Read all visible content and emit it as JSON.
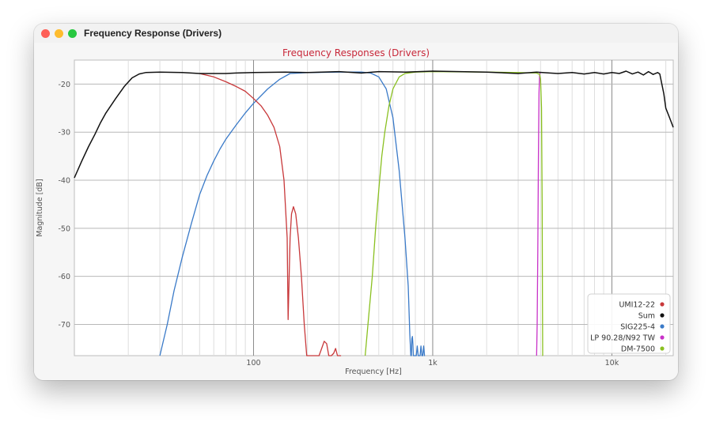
{
  "window": {
    "title": "Frequency Response (Drivers)"
  },
  "chart_data": {
    "type": "line",
    "title": "Frequency Responses (Drivers)",
    "xlabel": "Frequency [Hz]",
    "ylabel": "Magnitude [dB]",
    "xscale": "log",
    "xlim": [
      10,
      22000
    ],
    "ylim": [
      -76.5,
      -15
    ],
    "x_ticks": [
      100,
      1000,
      10000
    ],
    "x_tick_labels": [
      "100",
      "1k",
      "10k"
    ],
    "y_ticks": [
      -20,
      -30,
      -40,
      -50,
      -60,
      -70
    ],
    "grid": true,
    "legend_position": "bottom-right",
    "colors": {
      "title": "#c8283a",
      "axis_text": "#555555"
    },
    "series": [
      {
        "name": "UMI12-22",
        "color": "#c8383a",
        "x": [
          50,
          60,
          70,
          80,
          90,
          100,
          110,
          120,
          130,
          140,
          148,
          154,
          156,
          158,
          160,
          163,
          167,
          172,
          178,
          185,
          192,
          198,
          203,
          210,
          220,
          232,
          240,
          248,
          256,
          263,
          272,
          280,
          287,
          294,
          300,
          308
        ],
        "y": [
          -17.8,
          -18.5,
          -19.5,
          -20.5,
          -21.5,
          -23,
          -24.5,
          -26.5,
          -29,
          -33,
          -40,
          -52,
          -69,
          -60,
          -52,
          -47,
          -45.5,
          -47,
          -52,
          -60,
          -70,
          -76.5,
          -76.5,
          -76.5,
          -76.5,
          -76.5,
          -75,
          -73.5,
          -74,
          -76.5,
          -76.5,
          -76,
          -75,
          -76.5,
          -76.5,
          -76.5
        ]
      },
      {
        "name": "Sum",
        "color": "#111111",
        "x": [
          10,
          11,
          12,
          13,
          14,
          15,
          17,
          19,
          21,
          23,
          25,
          30,
          40,
          50,
          60,
          70,
          80,
          100,
          150,
          200,
          300,
          400,
          500,
          700,
          1000,
          2000,
          3000,
          3800,
          4500,
          5000,
          6000,
          7000,
          8000,
          9000,
          10000,
          11000,
          12000,
          13000,
          14000,
          15000,
          16000,
          17000,
          18000,
          18500,
          19000,
          19500,
          20000,
          21000,
          22000
        ],
        "y": [
          -39.5,
          -36,
          -33,
          -30.5,
          -28,
          -26,
          -23,
          -20.5,
          -18.7,
          -17.9,
          -17.6,
          -17.5,
          -17.6,
          -17.8,
          -17.8,
          -17.8,
          -17.7,
          -17.6,
          -17.5,
          -17.6,
          -17.4,
          -17.7,
          -17.4,
          -17.5,
          -17.3,
          -17.5,
          -17.8,
          -17.5,
          -17.7,
          -17.8,
          -17.6,
          -17.9,
          -17.6,
          -17.9,
          -17.6,
          -17.8,
          -17.3,
          -17.9,
          -17.5,
          -18.1,
          -17.4,
          -18,
          -17.6,
          -17.9,
          -20,
          -22,
          -25,
          -27,
          -29
        ]
      },
      {
        "name": "SIG225-4",
        "color": "#3a7ac8",
        "x": [
          30,
          33,
          36,
          40,
          45,
          50,
          55,
          60,
          65,
          70,
          80,
          90,
          100,
          120,
          140,
          160,
          200,
          300,
          400,
          450,
          500,
          550,
          600,
          650,
          700,
          730,
          745,
          755,
          760,
          765,
          770,
          775,
          780,
          785,
          790,
          800,
          810,
          820,
          830,
          840,
          850,
          860,
          870,
          880,
          890,
          900,
          905
        ],
        "y": [
          -76.5,
          -70,
          -63,
          -56,
          -49,
          -43,
          -39,
          -36,
          -33.5,
          -31.5,
          -28.5,
          -26,
          -24,
          -21,
          -19,
          -17.8,
          -17.6,
          -17.5,
          -17.5,
          -17.7,
          -18.5,
          -21,
          -27,
          -38,
          -52,
          -62,
          -72,
          -76.5,
          -76.5,
          -73,
          -72.5,
          -74,
          -76.5,
          -76.5,
          -76.5,
          -76.5,
          -76.5,
          -74.5,
          -76.5,
          -76.5,
          -76.5,
          -74.5,
          -76.5,
          -76.5,
          -74.5,
          -76.5,
          -76.5
        ]
      },
      {
        "name": "LP 90.28/N92 TW",
        "color": "#c832c8",
        "x": [
          3800,
          3830,
          3860,
          3890,
          3920,
          3950,
          3980
        ],
        "y": [
          -76.5,
          -70,
          -55,
          -35,
          -22,
          -18,
          -17.6
        ]
      },
      {
        "name": "DM-7500",
        "color": "#8ac020",
        "x": [
          420,
          440,
          460,
          480,
          500,
          520,
          540,
          570,
          600,
          650,
          700,
          800,
          1000,
          2000,
          3000,
          3800,
          3950,
          4000,
          4050,
          4080,
          4100,
          4110,
          4120
        ],
        "y": [
          -76.5,
          -68,
          -60,
          -50,
          -42,
          -35,
          -30,
          -24.5,
          -21,
          -18.5,
          -17.8,
          -17.5,
          -17.4,
          -17.5,
          -17.6,
          -17.7,
          -18,
          -19,
          -25,
          -45,
          -65,
          -76.5,
          -76.5
        ]
      }
    ]
  }
}
